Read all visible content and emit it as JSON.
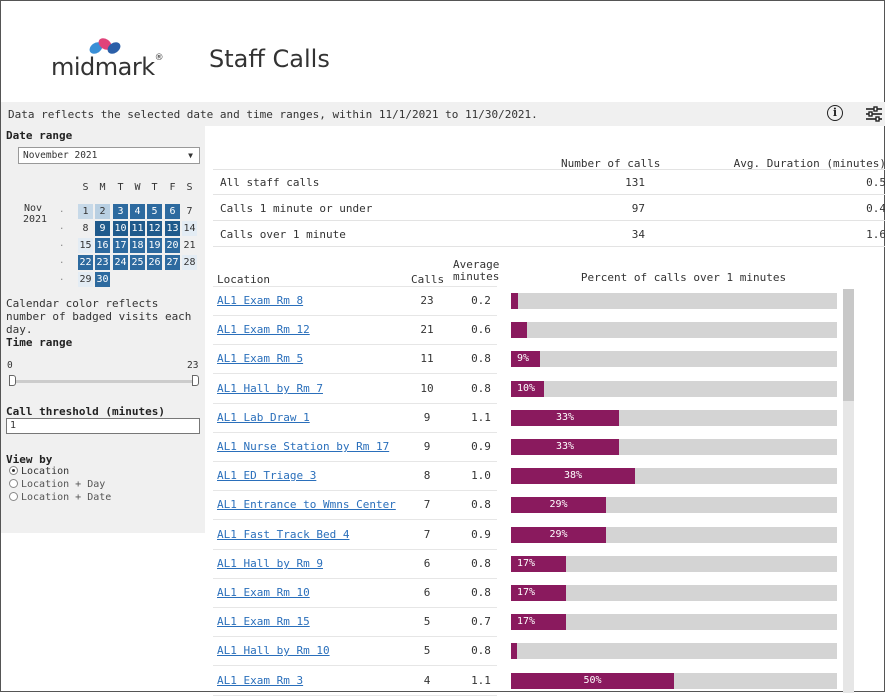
{
  "header": {
    "logo_text": "midmark",
    "logo_reg": "®",
    "title": "Staff Calls"
  },
  "info_bar": {
    "text": "Data reflects the selected date and time ranges, within 11/1/2021 to 11/30/2021.",
    "info_icon": "info-icon",
    "filter_icon": "sliders-icon"
  },
  "sidebar": {
    "date_range_label": "Date range",
    "month_select": "November 2021",
    "calendar": {
      "month": "Nov",
      "year": "2021",
      "weekdays": [
        "S",
        "M",
        "T",
        "W",
        "T",
        "F",
        "S"
      ],
      "weeks": [
        [
          "",
          "1",
          "2",
          "3",
          "4",
          "5",
          "6",
          "7"
        ],
        [
          "",
          "8",
          "9",
          "10",
          "11",
          "12",
          "13",
          "14"
        ],
        [
          ".",
          "15",
          "16",
          "17",
          "18",
          "19",
          "20",
          "21"
        ],
        [
          ".",
          "22",
          "23",
          "24",
          "25",
          "26",
          "27",
          "28"
        ],
        [
          ".",
          "29",
          "30"
        ]
      ]
    },
    "calendar_note": "Calendar color reflects number of badged visits each day.",
    "time_range_label": "Time range",
    "time_min": "0",
    "time_max": "23",
    "threshold_label": "Call threshold (minutes)",
    "threshold_value": "1",
    "view_by_label": "View by",
    "view_options": [
      "Location",
      "Location + Day",
      "Location + Date"
    ],
    "view_selected": "Location"
  },
  "summary": {
    "col_calls": "Number of calls",
    "col_duration": "Avg. Duration (minutes)",
    "rows": [
      {
        "label": "All staff calls",
        "calls": "131",
        "avg": "0.5"
      },
      {
        "label": "Calls 1 minute or under",
        "calls": "97",
        "avg": "0.4"
      },
      {
        "label": "Calls over 1 minute",
        "calls": "34",
        "avg": "1.6"
      }
    ]
  },
  "table": {
    "col_location": "Location",
    "col_calls": "Calls",
    "col_avg_1": "Average",
    "col_avg_2": "minutes",
    "col_percent": "Percent of calls over 1 minutes",
    "rows": [
      {
        "location": "AL1 Exam Rm 8",
        "calls": "23",
        "avg": "0.2",
        "pct": 2,
        "pct_label": ""
      },
      {
        "location": "AL1 Exam Rm 12",
        "calls": "21",
        "avg": "0.6",
        "pct": 5,
        "pct_label": ""
      },
      {
        "location": "AL1 Exam Rm 5",
        "calls": "11",
        "avg": "0.8",
        "pct": 9,
        "pct_label": "9%"
      },
      {
        "location": "AL1 Hall by Rm 7",
        "calls": "10",
        "avg": "0.8",
        "pct": 10,
        "pct_label": "10%"
      },
      {
        "location": "AL1 Lab Draw 1",
        "calls": "9",
        "avg": "1.1",
        "pct": 33,
        "pct_label": "33%"
      },
      {
        "location": "AL1 Nurse Station by Rm 17",
        "calls": "9",
        "avg": "0.9",
        "pct": 33,
        "pct_label": "33%"
      },
      {
        "location": "AL1 ED Triage 3",
        "calls": "8",
        "avg": "1.0",
        "pct": 38,
        "pct_label": "38%"
      },
      {
        "location": "AL1 Entrance to Wmns Center",
        "calls": "7",
        "avg": "0.8",
        "pct": 29,
        "pct_label": "29%"
      },
      {
        "location": "AL1 Fast Track Bed 4",
        "calls": "7",
        "avg": "0.9",
        "pct": 29,
        "pct_label": "29%"
      },
      {
        "location": "AL1 Hall by Rm 9",
        "calls": "6",
        "avg": "0.8",
        "pct": 17,
        "pct_label": "17%"
      },
      {
        "location": "AL1 Exam Rm 10",
        "calls": "6",
        "avg": "0.8",
        "pct": 17,
        "pct_label": "17%"
      },
      {
        "location": "AL1 Exam Rm 15",
        "calls": "5",
        "avg": "0.7",
        "pct": 17,
        "pct_label": "17%"
      },
      {
        "location": "AL1 Hall by Rm 10",
        "calls": "5",
        "avg": "0.8",
        "pct": 0,
        "pct_label": ""
      },
      {
        "location": "AL1 Exam Rm 3",
        "calls": "4",
        "avg": "1.1",
        "pct": 50,
        "pct_label": "50%"
      }
    ]
  },
  "colors": {
    "accent_bar": "#8a1a5e",
    "bar_bg": "#d4d4d4",
    "link": "#2a6fbb",
    "calendar_dark": "#1f5a8c"
  }
}
